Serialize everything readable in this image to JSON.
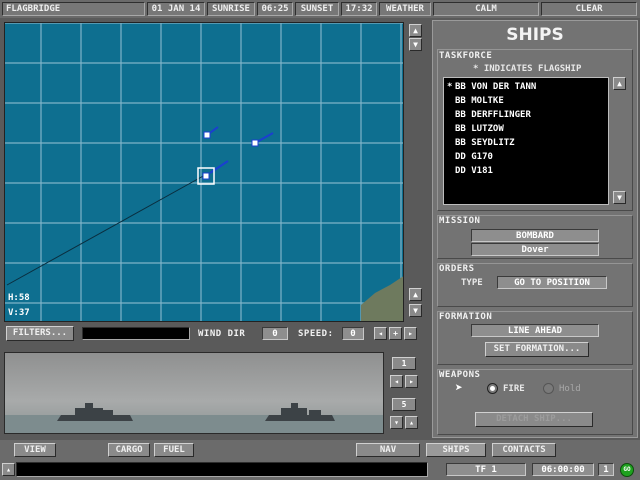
{
  "topbar": {
    "location": "FLAGBRIDGE",
    "date": "01 JAN 14",
    "sunrise_label": "SUNRISE",
    "sunrise_time": "06:25",
    "sunset_label": "SUNSET",
    "sunset_time": "17:32",
    "weather_label": "WEATHER",
    "sea": "CALM",
    "sky": "CLEAR"
  },
  "map": {
    "h_coord": "H:58",
    "v_coord": "V:37",
    "filters_label": "FILTERS...",
    "wind_dir_label": "WIND DIR",
    "wind_dir_value": "0",
    "speed_label": "SPEED:",
    "speed_value": "0"
  },
  "viewport": {
    "zoom_top": "1",
    "zoom_mid": "5"
  },
  "panel": {
    "title": "SHIPS",
    "taskforce_label": "TASKFORCE",
    "flagship_note": "* INDICATES FLAGSHIP",
    "ships": [
      {
        "flag": "*",
        "name": "BB VON DER TANN"
      },
      {
        "flag": "",
        "name": "BB MOLTKE"
      },
      {
        "flag": "",
        "name": "BB DERFFLINGER"
      },
      {
        "flag": "",
        "name": "BB LUTZOW"
      },
      {
        "flag": "",
        "name": "BB SEYDLITZ"
      },
      {
        "flag": "",
        "name": "DD G170"
      },
      {
        "flag": "",
        "name": "DD V181"
      }
    ],
    "mission_label": "MISSION",
    "mission_value": "BOMBARD",
    "mission_target": "Dover",
    "orders_label": "ORDERS",
    "orders_type_label": "TYPE",
    "orders_type_value": "GO TO POSITION",
    "formation_label": "FORMATION",
    "formation_value": "LINE AHEAD",
    "set_formation_label": "SET FORMATION...",
    "weapons_label": "WEAPONS",
    "fire_label": "FIRE",
    "hold_label": "Hold",
    "detach_label": "DETACH SHIP..."
  },
  "bottom": {
    "view_label": "VIEW",
    "cargo_label": "CARGO",
    "fuel_label": "FUEL",
    "nav_label": "NAV",
    "ships_label": "SHIPS",
    "contacts_label": "CONTACTS",
    "tf_label": "TF 1",
    "time": "06:00:00",
    "speed": "1",
    "go_label": "GO"
  },
  "colors": {
    "sea": "#0e6f90",
    "grid": "#7fb4c8",
    "panel": "#737373"
  }
}
